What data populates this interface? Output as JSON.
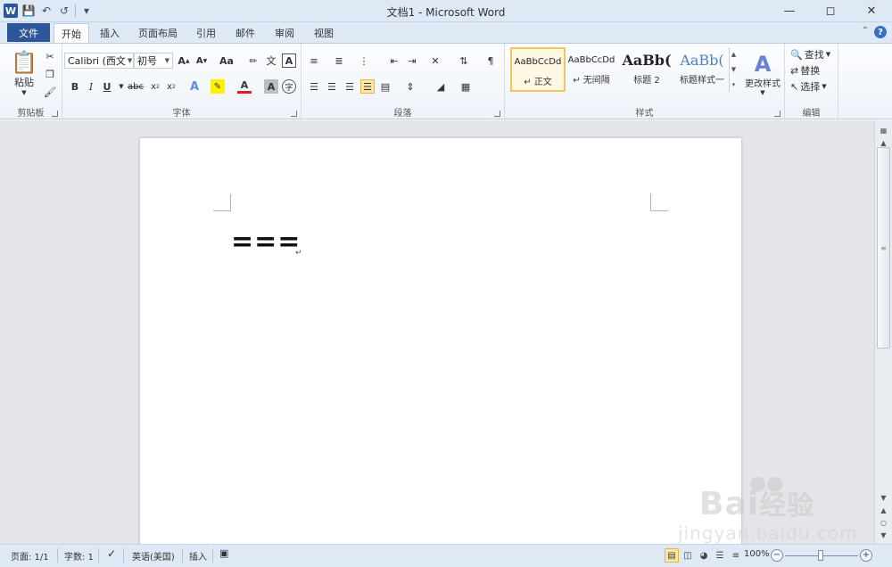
{
  "window": {
    "title": "文档1 - Microsoft Word",
    "app_icon": "W"
  },
  "tabs": {
    "file": "文件",
    "items": [
      "开始",
      "插入",
      "页面布局",
      "引用",
      "邮件",
      "审阅",
      "视图"
    ],
    "active": "开始"
  },
  "ribbon": {
    "clipboard": {
      "label": "剪贴板",
      "paste": "粘贴"
    },
    "font": {
      "label": "字体",
      "font_name": "Calibri (西文",
      "font_size": "初号",
      "change_case": "Aa"
    },
    "paragraph": {
      "label": "段落"
    },
    "styles": {
      "label": "样式",
      "items": [
        {
          "preview": "AaBbCcDd",
          "name": "正文"
        },
        {
          "preview": "AaBbCcDd",
          "name": "无间隔"
        },
        {
          "preview": "AaBb(",
          "name": "标题 2"
        },
        {
          "preview": "AaBb(",
          "name": "标题样式一"
        }
      ],
      "change_styles": "更改样式"
    },
    "editing": {
      "label": "编辑",
      "find": "查找",
      "replace": "替换",
      "select": "选择"
    }
  },
  "document": {
    "text": "==="
  },
  "statusbar": {
    "page": "页面: 1/1",
    "words": "字数: 1",
    "language": "英语(美国)",
    "mode": "插入",
    "zoom": "100%"
  },
  "watermark": {
    "brand": "Bai",
    "brand_cn": "经验",
    "url": "jingyan.baidu.com"
  },
  "colors": {
    "file_tab": "#2b579a",
    "title_bg": "#dfe9f5",
    "workspace": "#e3e5e8"
  }
}
